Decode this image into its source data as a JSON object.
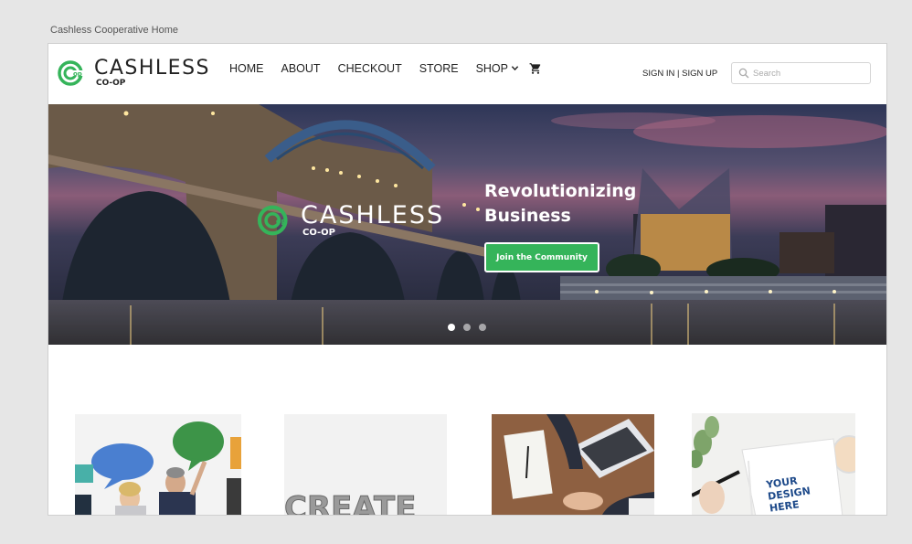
{
  "window": {
    "title": "Cashless Cooperative Home"
  },
  "brand": {
    "name": "CASHLESS",
    "sub": "CO-OP",
    "color": "#35b45a"
  },
  "nav": {
    "items": [
      "HOME",
      "ABOUT",
      "CHECKOUT",
      "STORE",
      "SHOP"
    ],
    "cart_icon": "shopping-cart-icon"
  },
  "auth": {
    "label": "SIGN IN | SIGN UP"
  },
  "search": {
    "placeholder": "Search",
    "value": ""
  },
  "hero": {
    "headline": "Revolutionizing Business",
    "cta": "Join the Community",
    "slide_count": 3,
    "active_slide": 1
  },
  "cards": [
    {
      "image": "people-speech-bubbles"
    },
    {
      "image": "create-letters"
    },
    {
      "image": "business-handshake-laptop"
    },
    {
      "image": "your-design-here-notebook",
      "text": "YOUR DESIGN HERE"
    }
  ]
}
